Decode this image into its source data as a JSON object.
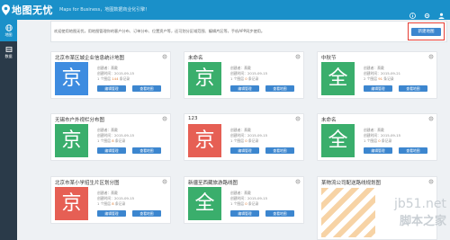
{
  "header": {
    "title": "地图无忧",
    "tagline": "Maps for Business，地图数据商业化引擎！"
  },
  "sidebar": {
    "items": [
      {
        "label": "地图"
      },
      {
        "label": "数据"
      }
    ]
  },
  "notice": {
    "text": "欢迎使用地图无忧，用地图管理你的客户分布、订单分布、位置资产等，还可划分区域范围、编辑片区等，手机APP同步使用。",
    "new_map_label": "新建地图"
  },
  "card_labels": {
    "creator_prefix": "创建者：",
    "created_prefix": "创建时间：",
    "edit": "编辑管理",
    "view": "查看地图"
  },
  "cards": [
    {
      "title": "北京市某区城企业信息统计地图",
      "thumb": "京",
      "color": "blue",
      "creator": "蔡戴",
      "date": "2015-09-15",
      "stats_pre": "1 个图层",
      "stats_num": "144",
      "stats_post": "条记录"
    },
    {
      "title": "未命名",
      "thumb": "京",
      "color": "green",
      "creator": "蔡戴",
      "date": "2015-09-15",
      "stats_pre": "1 个图层",
      "stats_num": "0",
      "stats_post": "条记录"
    },
    {
      "title": "中秋节",
      "thumb": "全",
      "color": "green",
      "creator": "蔡戴",
      "date": "2015-09-21",
      "stats_pre": "2 个图层",
      "stats_num": "91",
      "stats_post": "条记录"
    },
    {
      "title": "无锡市户外视栏分布图",
      "thumb": "京",
      "color": "green",
      "creator": "蔡戴",
      "date": "2015-09-15",
      "stats_pre": "1 个图层",
      "stats_num": "8",
      "stats_post": "条记录"
    },
    {
      "title": "123",
      "thumb": "京",
      "color": "red",
      "creator": "蔡戴",
      "date": "2015-09-15",
      "stats_pre": "1 个图层",
      "stats_num": "0",
      "stats_post": "条记录"
    },
    {
      "title": "未命名",
      "thumb": "全",
      "color": "green",
      "creator": "蔡戴",
      "date": "2015-09-15",
      "stats_pre": "1 个图层",
      "stats_num": "0",
      "stats_post": "条记录"
    },
    {
      "title": "北京市某小学招生片区划分图",
      "thumb": "京",
      "color": "red",
      "creator": "蔡戴",
      "date": "2015-09-15",
      "stats_pre": "1 个图层",
      "stats_num": "8",
      "stats_post": "条记录"
    },
    {
      "title": "新疆至西藏旅游路线图",
      "thumb": "全",
      "color": "green",
      "creator": "蔡戴",
      "date": "2015-09-15",
      "stats_pre": "1 个图层",
      "stats_num": "0",
      "stats_post": "条记录"
    }
  ],
  "partial_card": {
    "title": "某物流公司配送路线规划图"
  },
  "watermark": {
    "line1": "jb51.net",
    "line2": "脚本之家"
  },
  "colors": {
    "brand": "#1a90c9",
    "sidebar": "#2a3a49",
    "button": "#3c86cf",
    "highlight": "#e53c33"
  }
}
